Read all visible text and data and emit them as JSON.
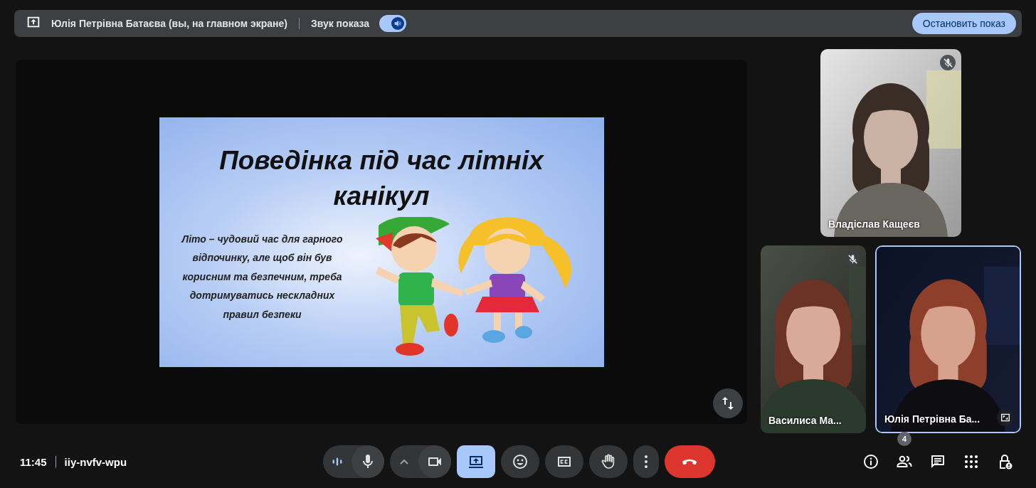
{
  "top_bar": {
    "presenter_label": "Юлія Петрівна Батаєва (вы, на главном экране)",
    "sound_label": "Звук показа",
    "sound_on": true,
    "stop_button": "Остановить показ"
  },
  "slide": {
    "title": "Поведінка під час літніх канікул",
    "body": "Літо – чудовий час для гарного відпочинку, але щоб він був корисним та безпечним, треба дотримуватись нескладних правил безпеки"
  },
  "tiles": [
    {
      "name": "Владіслав Кащеєв",
      "muted": true,
      "active": false
    },
    {
      "name": "Василиса Ма...",
      "muted": true,
      "active": false
    },
    {
      "name": "Юлія Петрівна Ба...",
      "muted": false,
      "active": true
    }
  ],
  "meeting": {
    "time": "11:45",
    "code": "iiy-nvfv-wpu"
  },
  "controls": [
    {
      "kind": "mic",
      "on": true
    },
    {
      "kind": "camera",
      "on": true
    },
    {
      "kind": "present",
      "selected": true
    },
    {
      "kind": "emoji",
      "selected": false
    },
    {
      "kind": "captions",
      "selected": false
    },
    {
      "kind": "hand",
      "selected": false
    },
    {
      "kind": "more"
    },
    {
      "kind": "end"
    }
  ],
  "side_buttons": [
    {
      "kind": "info"
    },
    {
      "kind": "people",
      "badge": "4"
    },
    {
      "kind": "chat"
    },
    {
      "kind": "apps"
    },
    {
      "kind": "host"
    }
  ]
}
